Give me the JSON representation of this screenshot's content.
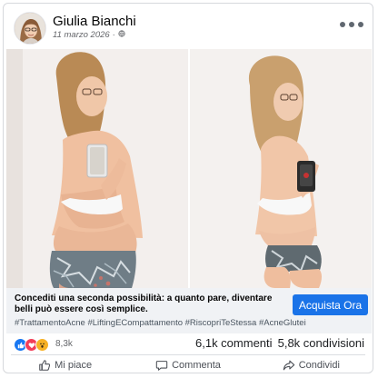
{
  "post": {
    "author": "Giulia Bianchi",
    "date": "11 marzo 2026",
    "privacy_icon": "globe-icon",
    "more_icon": "more-dots-icon"
  },
  "ad": {
    "text": "Concediti una seconda possibilità: a quanto pare, diventare belli può essere così semplice.",
    "cta_label": "Acquista Ora",
    "hashtags": "#TrattamentoAcne #LiftingECompattamento #RiscopriTeStessa #AcneGlutei"
  },
  "stats": {
    "reactions_count": "8,3k",
    "comments": "6,1k commenti",
    "shares": "5,8k condivisioni",
    "reaction_icons": [
      "like-icon",
      "love-icon",
      "wow-icon"
    ]
  },
  "actions": {
    "like": "Mi piace",
    "comment": "Commenta",
    "share": "Condividi"
  },
  "colors": {
    "cta": "#1a73e8",
    "like": "#1877f2",
    "love": "#f33e58",
    "wow": "#f7b125"
  }
}
